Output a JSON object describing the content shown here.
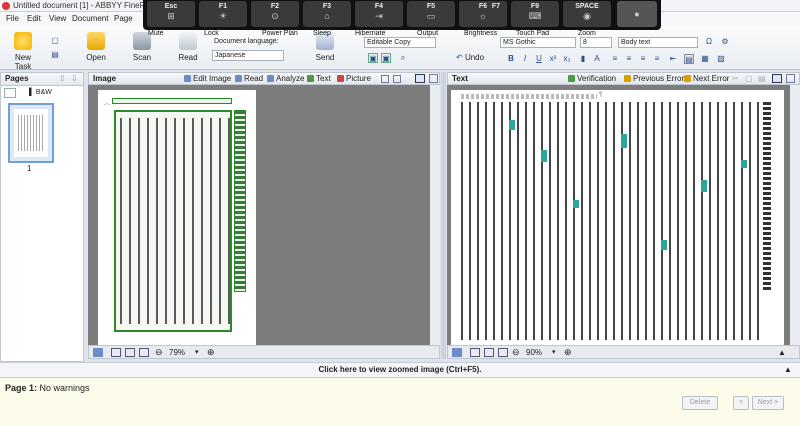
{
  "app": {
    "title": "Untitled document [1] - ABBYY FineRe"
  },
  "touchbar": {
    "keys": [
      {
        "key": "Esc",
        "glyph": "⊞"
      },
      {
        "key": "F1",
        "glyph": "☀"
      },
      {
        "key": "F2",
        "glyph": "⊙"
      },
      {
        "key": "F3",
        "glyph": "⌂"
      },
      {
        "key": "F4",
        "glyph": "⇥"
      },
      {
        "key": "F5",
        "glyph": "▭"
      },
      {
        "key": "F6",
        "glyph": "☼"
      },
      {
        "key": "F7",
        "glyph": ""
      },
      {
        "key": "F9",
        "glyph": "⌨"
      },
      {
        "key": "SPACE",
        "glyph": "◉"
      }
    ],
    "labels": [
      "Mute",
      "Lock",
      "Power Plan",
      "Sleep",
      "Hibernate",
      "Output",
      "Brightness",
      "Touch Pad",
      "Zoom"
    ]
  },
  "menu": [
    "File",
    "Edit",
    "View",
    "Document",
    "Page"
  ],
  "ribbon": {
    "new_task": "New Task",
    "open": "Open",
    "scan": "Scan",
    "read": "Read",
    "send": "Send",
    "doc_language_label": "Document language:",
    "doc_language_value": "Japanese",
    "format_value": "Editable Copy",
    "undo": "Undo",
    "font_value": "MS Gothic",
    "size_value": "8",
    "style_value": "Body text"
  },
  "pages_panel": {
    "title": "Pages",
    "mode": "B&W",
    "page_number": "1"
  },
  "image_pane": {
    "title": "Image",
    "tools": [
      "Edit Image",
      "Read",
      "Analyze",
      "Text",
      "Picture"
    ],
    "zoom": "79%"
  },
  "text_pane": {
    "title": "Text",
    "tools": [
      "Verification",
      "Previous Error",
      "Next Error"
    ],
    "zoom": "90%"
  },
  "zoom_hint": "Click here to view zoomed image (Ctrl+F5).",
  "status": {
    "page": "Page 1:",
    "message": "No warnings"
  },
  "buttons": {
    "delete": "Delete",
    "prev": "<",
    "next": "Next >"
  },
  "colors": {
    "brand_red": "#d33333",
    "zone_green": "#2a8a2a",
    "highlight_teal": "#2aa69a",
    "accent_blue": "#2b4f8a"
  }
}
